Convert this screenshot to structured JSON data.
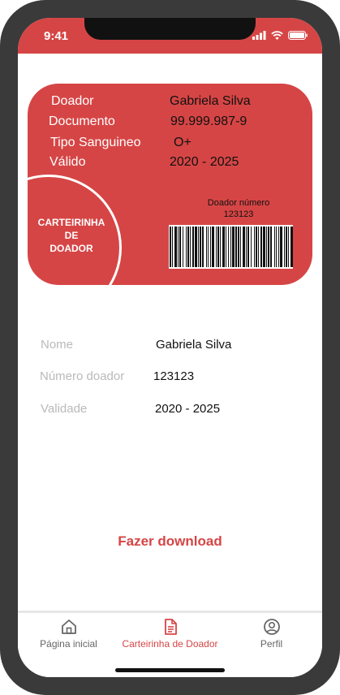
{
  "status_bar": {
    "time": "9:41"
  },
  "card": {
    "rows": [
      {
        "label": "Doador",
        "value": "Gabriela Silva"
      },
      {
        "label": "Documento",
        "value": "99.999.987-9"
      },
      {
        "label": "Tipo Sanguineo",
        "value": "O+"
      },
      {
        "label": "Válido",
        "value": "2020 - 2025"
      }
    ],
    "badge_line1": "CARTEIRINHA",
    "badge_line2": "DE",
    "badge_line3": "DOADOR",
    "donor_number_label": "Doador número",
    "donor_number": "123123"
  },
  "details": {
    "rows": [
      {
        "label": "Nome",
        "value": "Gabriela Silva"
      },
      {
        "label": "Número doador",
        "value": "123123"
      },
      {
        "label": "Validade",
        "value": "2020 - 2025"
      }
    ]
  },
  "download_label": "Fazer download",
  "tabs": [
    {
      "label": "Página inicial",
      "icon": "home-icon",
      "active": false
    },
    {
      "label": "Carteirinha de Doador",
      "icon": "document-icon",
      "active": true
    },
    {
      "label": "Perfil",
      "icon": "profile-icon",
      "active": false
    }
  ],
  "colors": {
    "accent": "#d64545",
    "frame": "#3a3a3a"
  }
}
